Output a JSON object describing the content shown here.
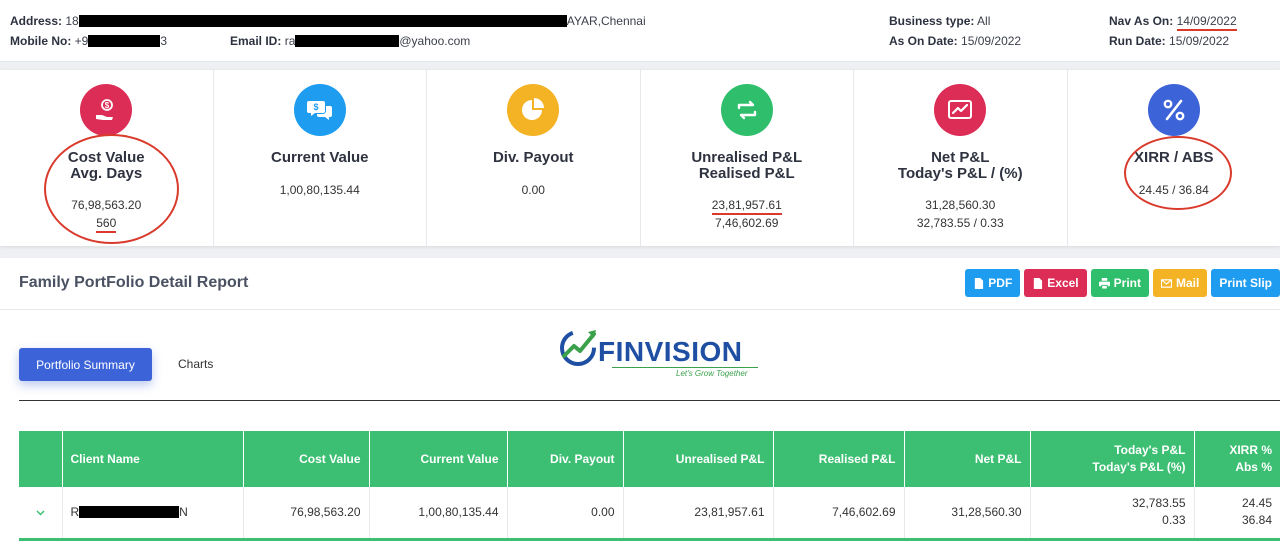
{
  "header": {
    "address_label": "Address:",
    "address_prefix": "18",
    "address_suffix": "AYAR,Chennai",
    "mobile_label": "Mobile No:",
    "mobile_prefix": "+9",
    "mobile_suffix": "3",
    "email_label": "Email ID:",
    "email_prefix": "ra",
    "email_suffix": "@yahoo.com",
    "business_type_label": "Business type:",
    "business_type_value": "All",
    "as_on_date_label": "As On Date:",
    "as_on_date_value": "15/09/2022",
    "nav_as_on_label": "Nav As On:",
    "nav_as_on_value": "14/09/2022",
    "run_date_label": "Run Date:",
    "run_date_value": "15/09/2022"
  },
  "cards": [
    {
      "title1": "Cost Value",
      "title2": "Avg. Days",
      "value1": "76,98,563.20",
      "value2": "560",
      "icon": "hand-money-icon",
      "color": "#dc2d57"
    },
    {
      "title1": "Current Value",
      "title2": "",
      "value1": "1,00,80,135.44",
      "value2": "",
      "icon": "money-chat-icon",
      "color": "#1e9cf0"
    },
    {
      "title1": "Div. Payout",
      "title2": "",
      "value1": "0.00",
      "value2": "",
      "icon": "pie-chart-icon",
      "color": "#f4b225"
    },
    {
      "title1": "Unrealised P&L",
      "title2": "Realised P&L",
      "value1": "23,81,957.61",
      "value2": "7,46,602.69",
      "icon": "exchange-icon",
      "color": "#2fbf6c"
    },
    {
      "title1": "Net P&L",
      "title2": "Today's P&L / (%)",
      "value1": "31,28,560.30",
      "value2": "32,783.55 / 0.33",
      "icon": "trend-chart-icon",
      "color": "#dc2d57"
    },
    {
      "title1": "XIRR / ABS",
      "title2": "",
      "value1": "24.45 / 36.84",
      "value2": "",
      "icon": "percent-icon",
      "color": "#3d63d8"
    }
  ],
  "report": {
    "title": "Family PortFolio Detail Report",
    "buttons": [
      {
        "label": "PDF",
        "color": "#1e9cf0",
        "icon": "pdf-file-icon"
      },
      {
        "label": "Excel",
        "color": "#dc2d57",
        "icon": "excel-file-icon"
      },
      {
        "label": "Print",
        "color": "#2fbf6c",
        "icon": "printer-icon"
      },
      {
        "label": "Mail",
        "color": "#f4b225",
        "icon": "mail-icon"
      },
      {
        "label": "Print Slip",
        "color": "#1e9cf0",
        "icon": ""
      }
    ]
  },
  "tabs": {
    "active": "Portfolio Summary",
    "other": "Charts"
  },
  "logo": {
    "word": "FINVISION",
    "tagline": "Let's Grow Together"
  },
  "table": {
    "headers": [
      "Client Name",
      "Cost Value",
      "Current Value",
      "Div. Payout",
      "Unrealised P&L",
      "Realised P&L",
      "Net P&L",
      "Today's P&L",
      "Today's P&L (%)",
      "XIRR %",
      "Abs %"
    ],
    "row": {
      "name_prefix": "R",
      "name_suffix": "N",
      "cost_value": "76,98,563.20",
      "current_value": "1,00,80,135.44",
      "div_payout": "0.00",
      "unrealised": "23,81,957.61",
      "realised": "7,46,602.69",
      "net": "31,28,560.30",
      "todays_pl": "32,783.55",
      "todays_pct": "0.33",
      "xirr": "24.45",
      "abs": "36.84"
    }
  },
  "colors": {
    "table_header": "#3cbf72",
    "accent_blue": "#3d63d8",
    "annotation_red": "#d93a2b"
  }
}
